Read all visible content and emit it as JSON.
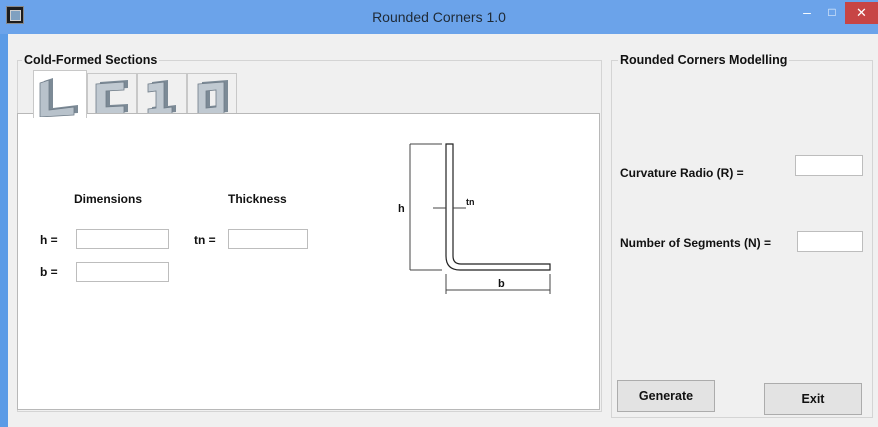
{
  "window": {
    "title": "Rounded Corners 1.0",
    "controls": {
      "minimize": "–",
      "maximize": "□",
      "close": "✕"
    }
  },
  "left_group": {
    "title": "Cold-Formed Sections",
    "tabs": [
      {
        "glyph": "L",
        "section": "L-section",
        "selected": true
      },
      {
        "glyph": "C",
        "section": "C-section",
        "selected": false
      },
      {
        "glyph": "1",
        "section": "I-section",
        "selected": false
      },
      {
        "glyph": "0",
        "section": "box-section",
        "selected": false
      }
    ],
    "dimensions_header": "Dimensions",
    "thickness_header": "Thickness",
    "h_label": "h =",
    "h_value": "",
    "b_label": "b =",
    "b_value": "",
    "tn_label": "tn =",
    "tn_value": "",
    "diagram": {
      "h": "h",
      "tn": "tn",
      "b": "b"
    }
  },
  "right_group": {
    "title": "Rounded Corners Modelling",
    "curvature_label": "Curvature Radio (R)  =",
    "curvature_value": "",
    "segments_label": "Number of Segments (N) =",
    "segments_value": ""
  },
  "buttons": {
    "generate": "Generate",
    "exit": "Exit"
  },
  "colors": {
    "title_bar": "#6ba3ea",
    "close_button": "#c74545",
    "form_background": "#f0f0f0"
  }
}
